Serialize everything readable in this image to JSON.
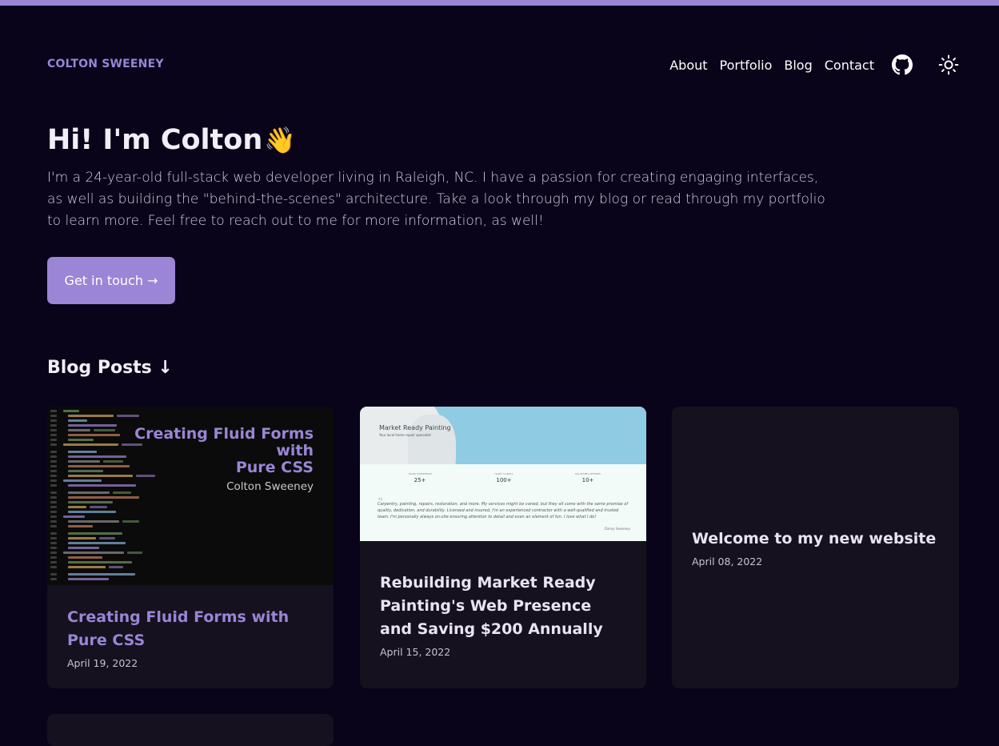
{
  "brand": "COLTON SWEENEY",
  "nav": {
    "about": "About",
    "portfolio": "Portfolio",
    "blog": "Blog",
    "contact": "Contact",
    "github_icon": "github-icon",
    "theme_icon": "sun-icon"
  },
  "hero": {
    "title": "Hi! I'm Colton",
    "emoji": "👋",
    "text": "I'm a 24-year-old full-stack web developer living in Raleigh, NC. I have a passion for creating engaging interfaces, as well as building the \"behind-the-scenes\" architecture. Take a look through my blog or read through my portfolio to learn more. Feel free to reach out to me for more information, as well!",
    "cta": "Get in touch →"
  },
  "blog": {
    "heading": "Blog Posts ↓",
    "posts": [
      {
        "title": "Creating Fluid Forms with Pure CSS",
        "date": "April 19, 2022",
        "thumb_title_1": "Creating Fluid Forms",
        "thumb_title_2": "with",
        "thumb_title_3": "Pure CSS",
        "thumb_author": "Colton Sweeney"
      },
      {
        "title": "Rebuilding Market Ready Painting's Web Presence and Saving $200 Annually",
        "date": "April 15, 2022",
        "thumb_brand": "Market Ready Painting",
        "thumb_tagline": "Your local home repair specialist",
        "thumb_stats": [
          {
            "label": "YEARS EXPERIENCE",
            "value": "25+"
          },
          {
            "label": "HAPPY CLIENTS",
            "value": "100+"
          },
          {
            "label": "SOLUTIONS OFFERED",
            "value": "10+"
          }
        ],
        "thumb_quote": "Carpentry, painting, repairs, restoration, and more. My services might be varied, but they all come with the same promise of quality, dedication, and durability. Licensed and insured, I'm an experienced contractor with a well-qualified and trusted team. I'm personally always on-site ensuring attention to detail and even an element of fun. I love what I do!",
        "thumb_sign": "Danny Sweeney"
      },
      {
        "title": "Welcome to my new website",
        "date": "April 08, 2022"
      }
    ]
  },
  "colors": {
    "background": "#090419",
    "accent": "#9a85d6",
    "card": "#16111f"
  }
}
